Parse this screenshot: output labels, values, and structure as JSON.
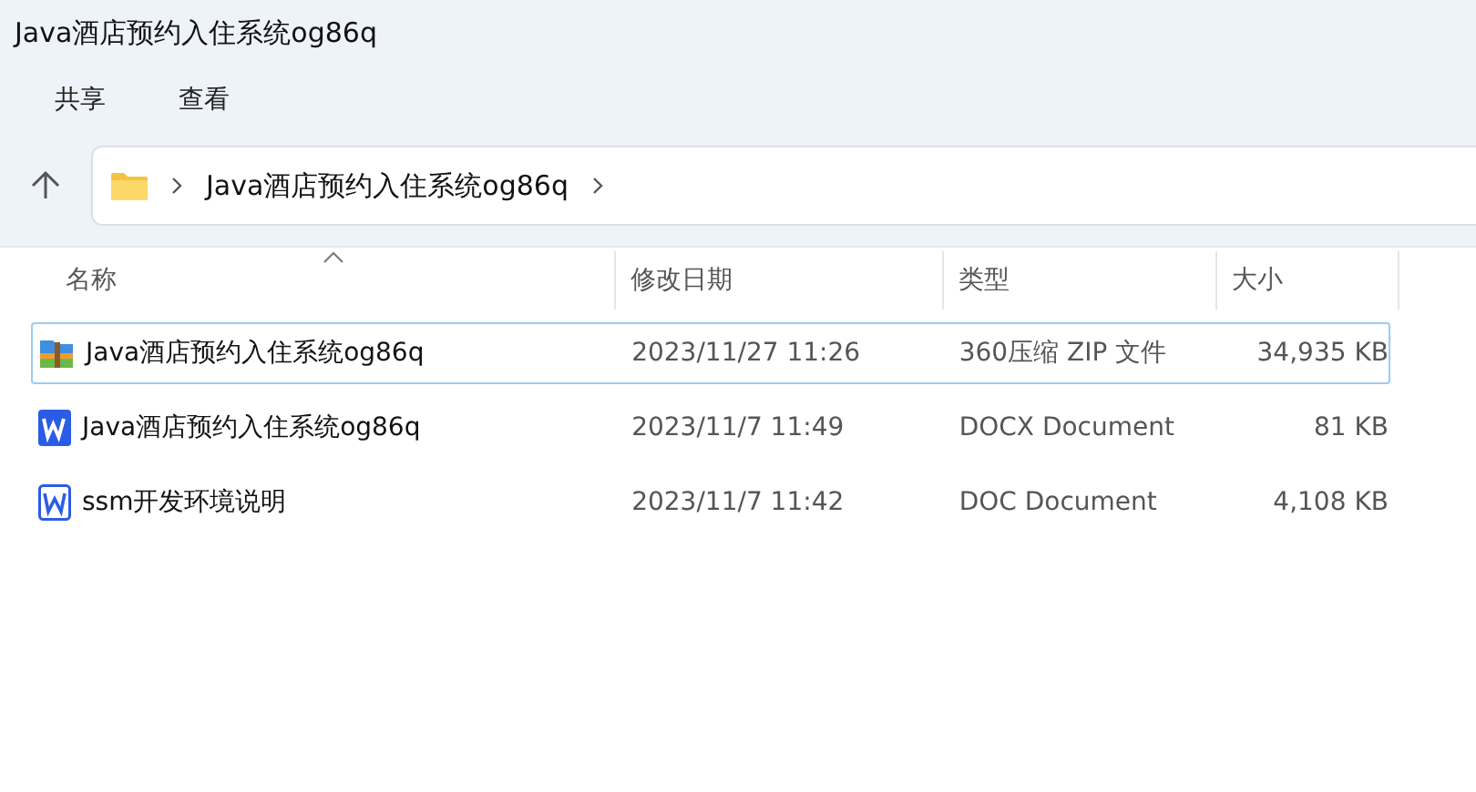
{
  "window": {
    "title": "Java酒店预约入住系统og86q"
  },
  "menu": [
    "共享",
    "查看"
  ],
  "address_bar": {
    "path": [
      "Java酒店预约入住系统og86q"
    ]
  },
  "table": {
    "columns": [
      {
        "label": "名称",
        "sorted": true
      },
      {
        "label": "修改日期",
        "sorted": false
      },
      {
        "label": "类型",
        "sorted": false
      },
      {
        "label": "大小",
        "sorted": false
      }
    ],
    "rows": [
      {
        "kind": "zip",
        "name": "Java酒店预约入住系统og86q",
        "modified": "2023/11/27 11:26",
        "type": "360压缩 ZIP 文件",
        "size": "34,935 KB",
        "focused": true
      },
      {
        "kind": "docx",
        "name": "Java酒店预约入住系统og86q",
        "modified": "2023/11/7 11:49",
        "type": "DOCX Document",
        "size": "81 KB",
        "focused": false
      },
      {
        "kind": "doc",
        "name": "ssm开发环境说明",
        "modified": "2023/11/7 11:42",
        "type": "DOC Document",
        "size": "4,108 KB",
        "focused": false
      }
    ]
  }
}
